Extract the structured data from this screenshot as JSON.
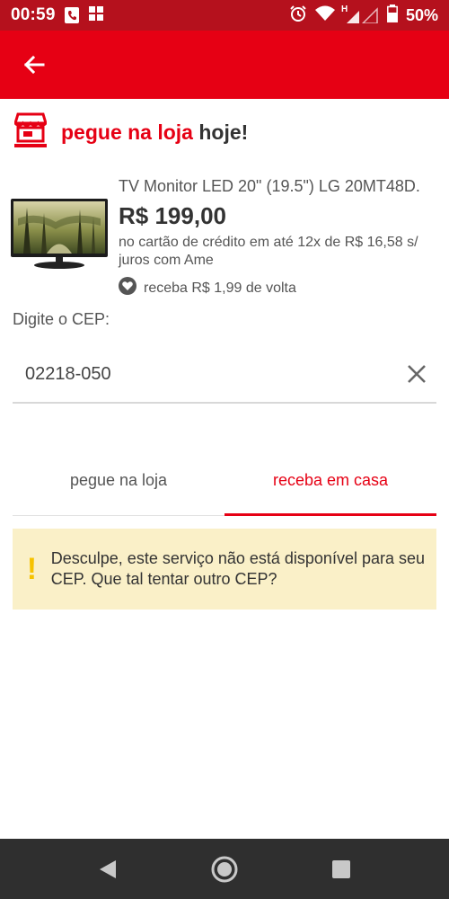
{
  "status_bar": {
    "time": "00:59",
    "network": "H",
    "battery": "50%"
  },
  "app_bar": {
    "back_icon": "arrow-left-icon"
  },
  "header": {
    "title_red": "pegue na loja",
    "title_dark": "hoje!",
    "icon": "store-icon"
  },
  "product": {
    "name": "TV Monitor LED 20\" (19.5\") LG 20MT48D.",
    "price": "R$ 199,00",
    "installments": "no cartão de crédito em até 12x de R$ 16,58 s/ juros com Ame",
    "cashback": "receba R$ 1,99 de volta"
  },
  "cep": {
    "label": "Digite o CEP:",
    "value": "02218-050"
  },
  "tabs": [
    {
      "label": "pegue na loja",
      "active": false
    },
    {
      "label": "receba em casa",
      "active": true
    }
  ],
  "warning": {
    "icon": "!",
    "message": "Desculpe, este serviço não está disponível para seu CEP. Que tal tentar outro CEP?"
  },
  "colors": {
    "status_bar": "#b5111d",
    "app_bar": "#e60014",
    "accent": "#e60014",
    "warning_bg": "#faf0c8",
    "warning_icon": "#f6c200",
    "nav_bar": "#2f2f2f"
  }
}
